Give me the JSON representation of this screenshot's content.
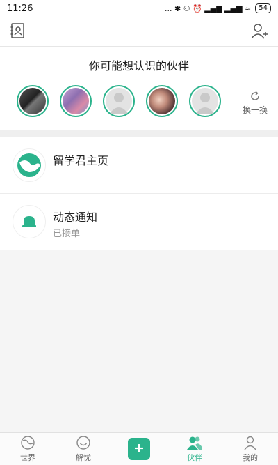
{
  "status_bar": {
    "time": "11:26",
    "indicators": "... ✱ ⚇ ⏰ ▂▄▆ ▂▄▆ ≈",
    "battery": "54"
  },
  "suggest": {
    "title": "你可能想认识的伙伴",
    "swap_label": "换一换",
    "avatars": [
      {
        "kind": "photo",
        "color": "#3b3b3b"
      },
      {
        "kind": "photo",
        "color": "#9d7bb0"
      },
      {
        "kind": "placeholder",
        "color": "#d9d9d9"
      },
      {
        "kind": "photo",
        "color": "#b08a8a"
      },
      {
        "kind": "placeholder",
        "color": "#d9d9d9"
      }
    ]
  },
  "list": [
    {
      "title": "留学君主页",
      "subtitle": "",
      "icon": "globe-logo-icon"
    },
    {
      "title": "动态通知",
      "subtitle": "已接单",
      "icon": "bell-icon"
    }
  ],
  "tabs": [
    {
      "label": "世界",
      "icon": "globe-icon",
      "active": false
    },
    {
      "label": "解忧",
      "icon": "smile-icon",
      "active": false
    },
    {
      "label": "",
      "icon": "plus-icon",
      "active": false
    },
    {
      "label": "伙伴",
      "icon": "friends-icon",
      "active": true
    },
    {
      "label": "我的",
      "icon": "person-icon",
      "active": false
    }
  ],
  "colors": {
    "accent": "#2bb38c",
    "text": "#222222",
    "subtext": "#9a9a9a"
  }
}
